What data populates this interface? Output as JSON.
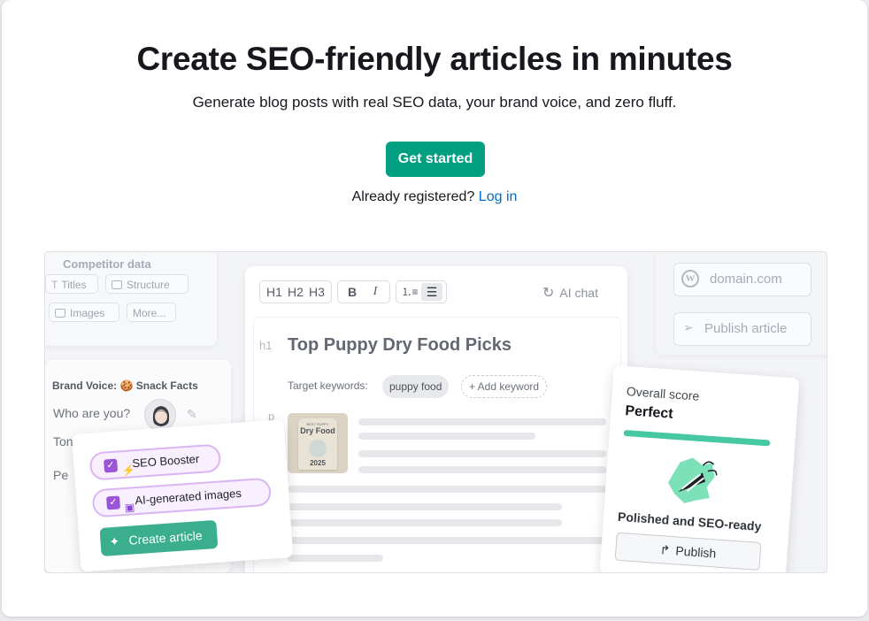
{
  "hero": {
    "title": "Create SEO-friendly articles in minutes",
    "subtitle": "Generate blog posts with real SEO data, your brand voice, and zero fluff.",
    "cta_label": "Get started",
    "login_prompt": "Already registered?",
    "login_link": "Log in"
  },
  "illustration": {
    "competitor": {
      "title": "Competitor data",
      "chips": [
        "Titles",
        "Structure",
        "Images",
        "More..."
      ]
    },
    "brand_voice": {
      "title": "Brand Voice: 🍪 Snack Facts",
      "fields": [
        "Who are you?",
        "Tone",
        "Pe"
      ]
    },
    "options": {
      "items": [
        "SEO Booster",
        "AI-generated images"
      ],
      "create_label": "Create article"
    },
    "editor": {
      "toolbar": [
        "H1",
        "H2",
        "H3",
        "B",
        "I"
      ],
      "ai_chat": "AI chat",
      "h1_tag": "h1",
      "p_tag": "p",
      "article_title": "Top Puppy Dry Food Picks",
      "keywords_label": "Target keywords:",
      "keyword": "puppy food",
      "add_keyword": "+ Add keyword",
      "image_text": [
        "BEST PUPPY",
        "Dry Food",
        "2025"
      ]
    },
    "publish_panel": {
      "domain": "domain.com",
      "publish_label": "Publish article"
    },
    "score": {
      "label": "Overall score",
      "value": "Perfect",
      "progress": 1.0,
      "caption": "Polished and SEO-ready",
      "button": "Publish"
    }
  },
  "colors": {
    "accent": "#009f81",
    "link": "#006dca",
    "purple": "#9a55d6",
    "score_bar": "#46c9a2"
  }
}
